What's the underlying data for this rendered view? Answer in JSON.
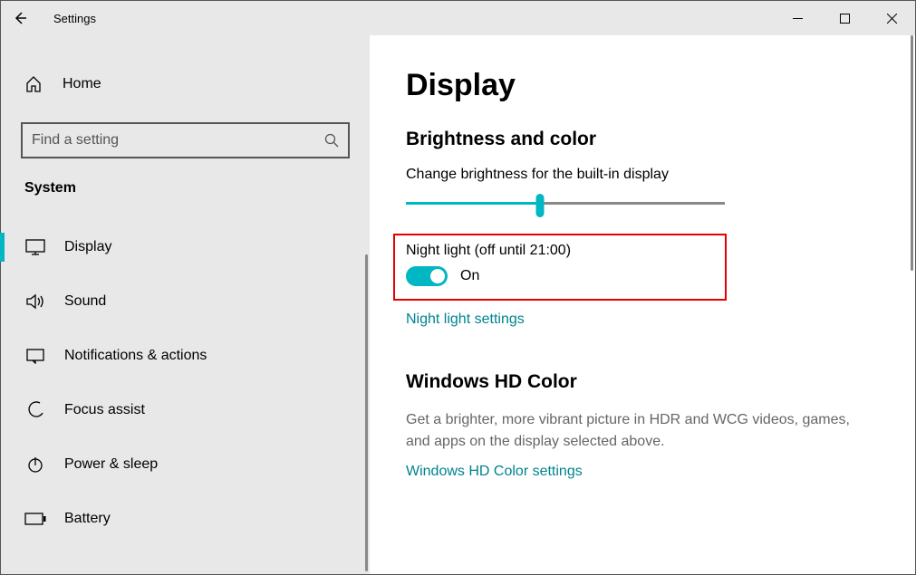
{
  "titlebar": {
    "title": "Settings"
  },
  "sidebar": {
    "home": "Home",
    "search_placeholder": "Find a setting",
    "category": "System",
    "items": [
      {
        "label": "Display"
      },
      {
        "label": "Sound"
      },
      {
        "label": "Notifications & actions"
      },
      {
        "label": "Focus assist"
      },
      {
        "label": "Power & sleep"
      },
      {
        "label": "Battery"
      }
    ]
  },
  "content": {
    "page_title": "Display",
    "brightness": {
      "heading": "Brightness and color",
      "slider_label": "Change brightness for the built-in display",
      "slider_percent": 42,
      "night_light_label": "Night light (off until 21:00)",
      "toggle_state": "On",
      "night_light_link": "Night light settings"
    },
    "hdcolor": {
      "heading": "Windows HD Color",
      "desc": "Get a brighter, more vibrant picture in HDR and WCG videos, games, and apps on the display selected above.",
      "link": "Windows HD Color settings"
    }
  }
}
